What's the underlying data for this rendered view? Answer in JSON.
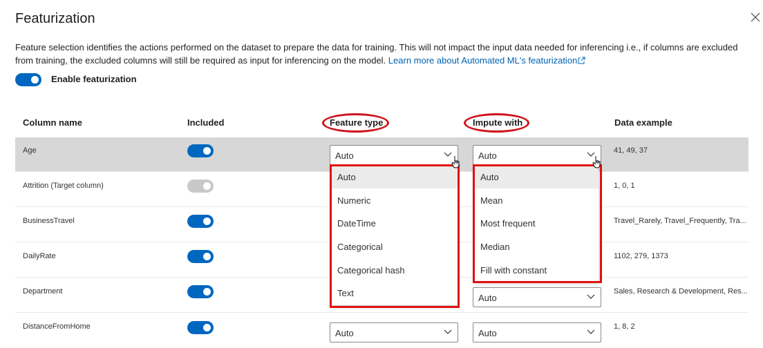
{
  "dialog": {
    "title": "Featurization",
    "description": "Feature selection identifies the actions performed on the dataset to prepare the data for training. This will not impact the input data needed for inferencing i.e., if columns are excluded from training, the excluded columns will still be required as input for inferencing on the model.",
    "learn_more": "Learn more about Automated ML's featurization",
    "enable_label": "Enable featurization",
    "enable_on": true
  },
  "table": {
    "headers": {
      "column_name": "Column name",
      "included": "Included",
      "feature_type": "Feature type",
      "impute_with": "Impute with",
      "data_example": "Data example"
    },
    "rows": [
      {
        "name": "Age",
        "included": true,
        "feature_type": "Auto",
        "impute_with": "Auto",
        "example": "41, 49, 37"
      },
      {
        "name": "Attrition (Target column)",
        "included": true,
        "feature_type": "",
        "impute_with": "",
        "example": "1, 0, 1"
      },
      {
        "name": "BusinessTravel",
        "included": true,
        "feature_type": "",
        "impute_with": "",
        "example": "Travel_Rarely, Travel_Frequently, Tra..."
      },
      {
        "name": "DailyRate",
        "included": true,
        "feature_type": "",
        "impute_with": "",
        "example": "1102, 279, 1373"
      },
      {
        "name": "Department",
        "included": true,
        "feature_type": "",
        "impute_with": "Auto",
        "example": "Sales, Research & Development, Res..."
      },
      {
        "name": "DistanceFromHome",
        "included": true,
        "feature_type": "Auto",
        "impute_with": "Auto",
        "example": "1, 8, 2"
      }
    ]
  },
  "feature_type_menu": [
    "Auto",
    "Numeric",
    "DateTime",
    "Categorical",
    "Categorical hash",
    "Text"
  ],
  "impute_menu": [
    "Auto",
    "Mean",
    "Most frequent",
    "Median",
    "Fill with constant"
  ],
  "colors": {
    "accent": "#0067c0",
    "annotation": "#e01010",
    "selected_row": "#d7d7d7"
  }
}
